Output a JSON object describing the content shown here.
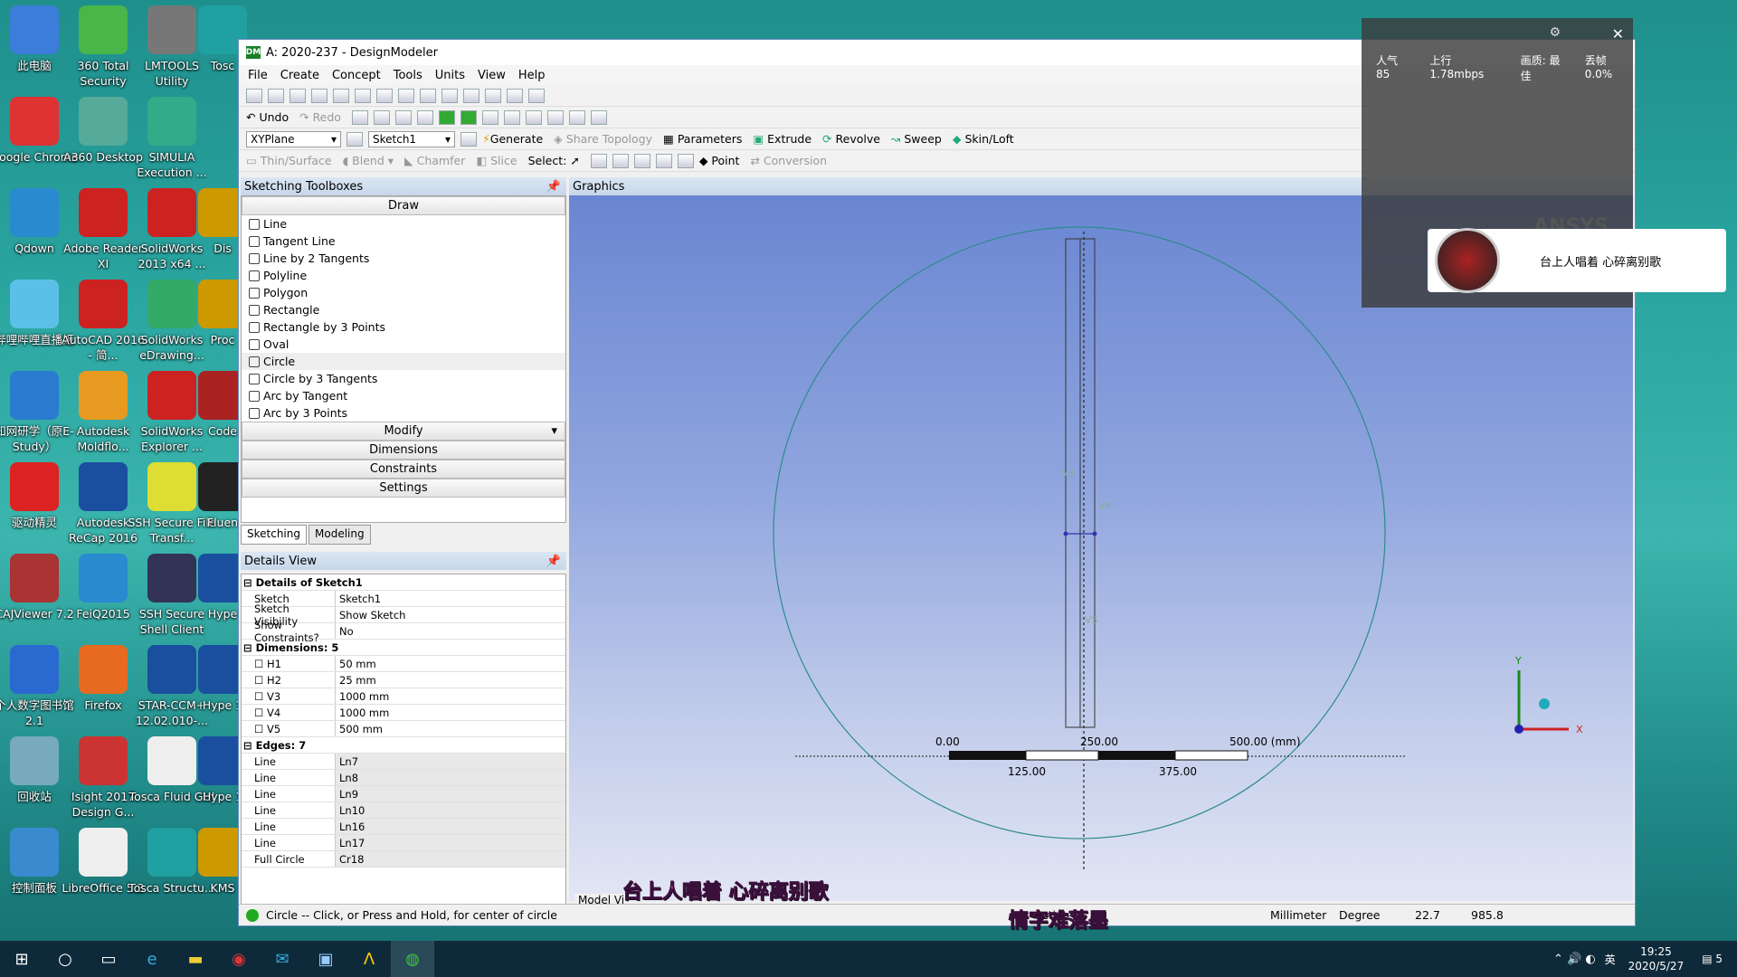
{
  "desktop": {
    "icons": [
      {
        "label": "此电脑",
        "color": "#3b7dd8"
      },
      {
        "label": "360 Total Security",
        "color": "#48b648"
      },
      {
        "label": "LMTOOLS Utility",
        "color": "#777"
      },
      {
        "label": "Tosc",
        "color": "#20a0a0"
      },
      {
        "label": "Google Chrome",
        "color": "#d33"
      },
      {
        "label": "A360 Desktop",
        "color": "#5a9"
      },
      {
        "label": "SIMULIA Execution ...",
        "color": "#3a8"
      },
      {
        "label": "Qdown",
        "color": "#2a8ad0"
      },
      {
        "label": "Adobe Reader XI",
        "color": "#c22"
      },
      {
        "label": "SolidWorks 2013 x64 ...",
        "color": "#c22"
      },
      {
        "label": "Dis",
        "color": "#c90"
      },
      {
        "label": "哔哩哔哩直播姬",
        "color": "#5bc0e8"
      },
      {
        "label": "AutoCAD 2016 - 简...",
        "color": "#c22"
      },
      {
        "label": "SolidWorks eDrawing...",
        "color": "#3a6"
      },
      {
        "label": "Proc",
        "color": "#c90"
      },
      {
        "label": "知网研学（原E-Study）",
        "color": "#2a7ad0"
      },
      {
        "label": "Autodesk Moldflo...",
        "color": "#e89a20"
      },
      {
        "label": "SolidWorks Explorer ...",
        "color": "#c22"
      },
      {
        "label": "Code",
        "color": "#a22"
      },
      {
        "label": "驱动精灵",
        "color": "#d22"
      },
      {
        "label": "Autodesk ReCap 2016",
        "color": "#1a4fa0"
      },
      {
        "label": "SSH Secure File Transf...",
        "color": "#dd3"
      },
      {
        "label": "Fluen",
        "color": "#222"
      },
      {
        "label": "CAJViewer 7.2",
        "color": "#a33"
      },
      {
        "label": "FeiQ2015",
        "color": "#2a8ad0"
      },
      {
        "label": "SSH Secure Shell Client",
        "color": "#335"
      },
      {
        "label": "Hype",
        "color": "#1a4fa0"
      },
      {
        "label": "个人数字图书馆2.1",
        "color": "#2a6ad0"
      },
      {
        "label": "Firefox",
        "color": "#e86a20"
      },
      {
        "label": "STAR-CCM+ 12.02.010-...",
        "color": "#1a4fa0"
      },
      {
        "label": "Hype 1",
        "color": "#1a4fa0"
      },
      {
        "label": "回收站",
        "color": "#7ab"
      },
      {
        "label": "Isight 2017 Design G...",
        "color": "#c33"
      },
      {
        "label": "Tosca Fluid GUI",
        "color": "#eee"
      },
      {
        "label": "Hype 1",
        "color": "#1a4fa0"
      },
      {
        "label": "控制面板",
        "color": "#3a8ad0"
      },
      {
        "label": "LibreOffice 5.3",
        "color": "#eee"
      },
      {
        "label": "Tosca Structu...",
        "color": "#20a0a0"
      },
      {
        "label": "KMS",
        "color": "#c90"
      }
    ]
  },
  "window": {
    "title": "A: 2020-237 - DesignModeler",
    "app_badge": "DM",
    "menu": [
      "File",
      "Create",
      "Concept",
      "Tools",
      "Units",
      "View",
      "Help"
    ],
    "toolbar2": {
      "undo": "Undo",
      "redo": "Redo"
    },
    "toolbar3": {
      "plane": "XYPlane",
      "sketch": "Sketch1",
      "generate": "Generate",
      "share_topology": "Share Topology",
      "parameters": "Parameters",
      "extrude": "Extrude",
      "revolve": "Revolve",
      "sweep": "Sweep",
      "skinloft": "Skin/Loft"
    },
    "toolbar4": {
      "thin": "Thin/Surface",
      "blend": "Blend",
      "chamfer": "Chamfer",
      "slice": "Slice",
      "select": "Select:",
      "point": "Point",
      "conversion": "Conversion"
    }
  },
  "sketching": {
    "header": "Sketching Toolboxes",
    "draw": "Draw",
    "items": [
      "Line",
      "Tangent Line",
      "Line by 2 Tangents",
      "Polyline",
      "Polygon",
      "Rectangle",
      "Rectangle by 3 Points",
      "Oval",
      "Circle",
      "Circle by 3 Tangents",
      "Arc by Tangent",
      "Arc by 3 Points"
    ],
    "modify": "Modify",
    "dimensions": "Dimensions",
    "constraints": "Constraints",
    "settings": "Settings",
    "tabs": [
      "Sketching",
      "Modeling"
    ]
  },
  "details": {
    "header": "Details View",
    "title": "Details of Sketch1",
    "rows": [
      {
        "k": "Sketch",
        "v": "Sketch1"
      },
      {
        "k": "Sketch Visibility",
        "v": "Show Sketch"
      },
      {
        "k": "Show Constraints?",
        "v": "No"
      }
    ],
    "dims_title": "Dimensions: 5",
    "dims": [
      {
        "k": "H1",
        "v": "50 mm"
      },
      {
        "k": "H2",
        "v": "25 mm"
      },
      {
        "k": "V3",
        "v": "1000 mm"
      },
      {
        "k": "V4",
        "v": "1000 mm"
      },
      {
        "k": "V5",
        "v": "500 mm"
      }
    ],
    "edges_title": "Edges: 7",
    "edges": [
      {
        "k": "Line",
        "v": "Ln7"
      },
      {
        "k": "Line",
        "v": "Ln8"
      },
      {
        "k": "Line",
        "v": "Ln9"
      },
      {
        "k": "Line",
        "v": "Ln10"
      },
      {
        "k": "Line",
        "v": "Ln16"
      },
      {
        "k": "Line",
        "v": "Ln17"
      },
      {
        "k": "Full Circle",
        "v": "Cr18"
      }
    ]
  },
  "graphics": {
    "header": "Graphics",
    "ansys": "ANSYS",
    "labels": {
      "v3": "V3",
      "v4": "V4",
      "v5": "V5"
    },
    "scale": {
      "t0": "0.00",
      "t250": "250.00",
      "t500": "500.00 (mm)",
      "t125": "125.00",
      "t375": "375.00"
    },
    "axes": {
      "x": "X",
      "y": "Y"
    },
    "model_view": "Model Vi"
  },
  "status": {
    "message": "Circle -- Click, or Press and Hold, for center of circle",
    "selection": "ection",
    "units": "Millimeter",
    "angle": "Degree",
    "x": "22.7",
    "y": "985.8"
  },
  "stream": {
    "popularity": "人气  85",
    "upload": "上行  1.78mbps",
    "quality": "画质: 最佳",
    "loss": "丢帧 0.0%",
    "popup_text": "台上人唱着 心碎离别歌"
  },
  "subtitles": {
    "line1": "台上人唱着 心碎离别歌",
    "line2": "情字难落墨"
  },
  "taskbar": {
    "time": "19:25",
    "date": "2020/5/27",
    "ime": "英",
    "notif": "5"
  }
}
